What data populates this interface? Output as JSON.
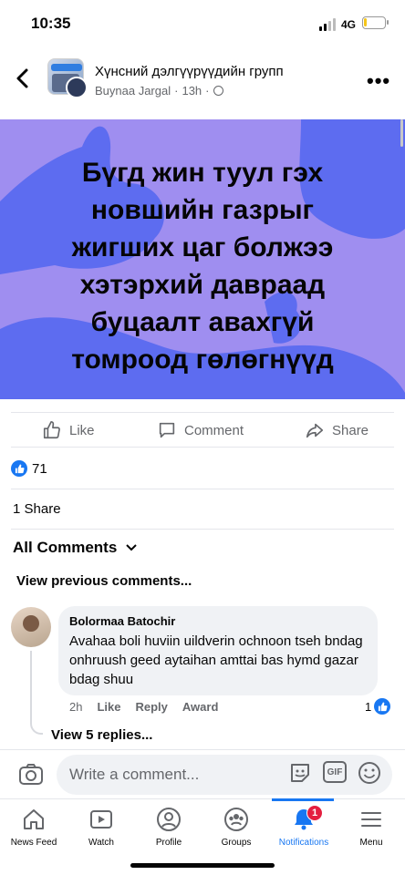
{
  "status_bar": {
    "time": "10:35",
    "network": "4G",
    "battery_level": 0.15
  },
  "header": {
    "group_name": "Хүнсний дэлгүүрүүдийн групп",
    "author": "Buynaa Jargal",
    "time_ago": "13h",
    "avatar_tag": "7777-8300"
  },
  "post": {
    "image_text": "Бүгд жин туул гэх новшийн газрыг жигших цаг болжээ хэтэрхий давраад буцаалт авахгүй томроод гөлөгнүүд",
    "image_bg_color": "#9f8ef0",
    "shape_color": "#5d6cf0"
  },
  "actions": {
    "like": "Like",
    "comment": "Comment",
    "share": "Share"
  },
  "reactions": {
    "count": "71"
  },
  "shares": "1 Share",
  "comments_filter": "All Comments",
  "view_previous": "View previous comments...",
  "comment": {
    "author": "Bolormaa Batochir",
    "text": "Avahaa boli huviin uildverin ochnoon tseh bndag onhruush geed aytaihan amttai bas hymd gazar bdag shuu",
    "time": "2h",
    "like": "Like",
    "reply": "Reply",
    "award": "Award",
    "reaction_count": "1"
  },
  "view_replies": "View 5 replies...",
  "write_comment": {
    "placeholder": "Write a comment...",
    "gif_label": "GIF"
  },
  "bottom_nav": [
    {
      "label": "News Feed",
      "icon": "home-icon"
    },
    {
      "label": "Watch",
      "icon": "video-icon"
    },
    {
      "label": "Profile",
      "icon": "profile-icon"
    },
    {
      "label": "Groups",
      "icon": "groups-icon"
    },
    {
      "label": "Notifications",
      "icon": "bell-icon",
      "active": true,
      "badge": "1"
    },
    {
      "label": "Menu",
      "icon": "menu-icon"
    }
  ],
  "colors": {
    "accent": "#1877f2",
    "badge": "#e41e3f",
    "secondary_text": "#65676b"
  }
}
